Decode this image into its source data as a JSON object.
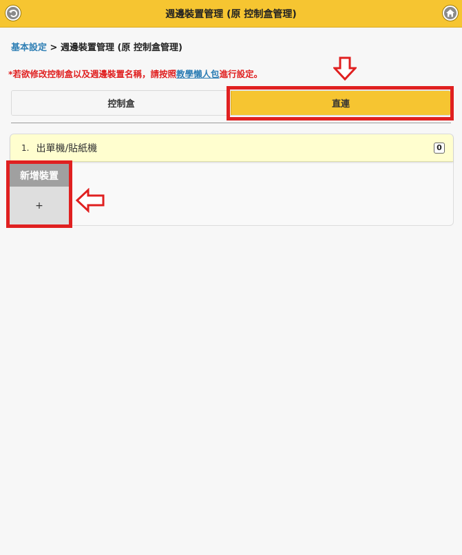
{
  "header": {
    "title": "週邊裝置管理 (原 控制盒管理)",
    "back_icon": "back-arrow-icon",
    "home_icon": "home-icon",
    "color": "#f6c531"
  },
  "breadcrumb": {
    "parent": "基本設定",
    "separator": " > ",
    "current": "週邊裝置管理 (原 控制盒管理)"
  },
  "notice": {
    "before": "*若欲修改控制盒以及週邊裝置名稱，請按照",
    "link": "教學懶人包",
    "after": "進行設定。",
    "color": "#e02020"
  },
  "tabs": [
    {
      "label": "控制盒",
      "active": false
    },
    {
      "label": "直連",
      "active": true
    }
  ],
  "devices": [
    {
      "number": "1.",
      "label": "出單機/貼紙機",
      "count": "0"
    }
  ],
  "add_device": {
    "label": "新增裝置",
    "plus": "+"
  },
  "annotations": {
    "highlight_color": "#e02020",
    "icons": [
      "down-arrow-icon",
      "left-arrow-icon"
    ]
  }
}
